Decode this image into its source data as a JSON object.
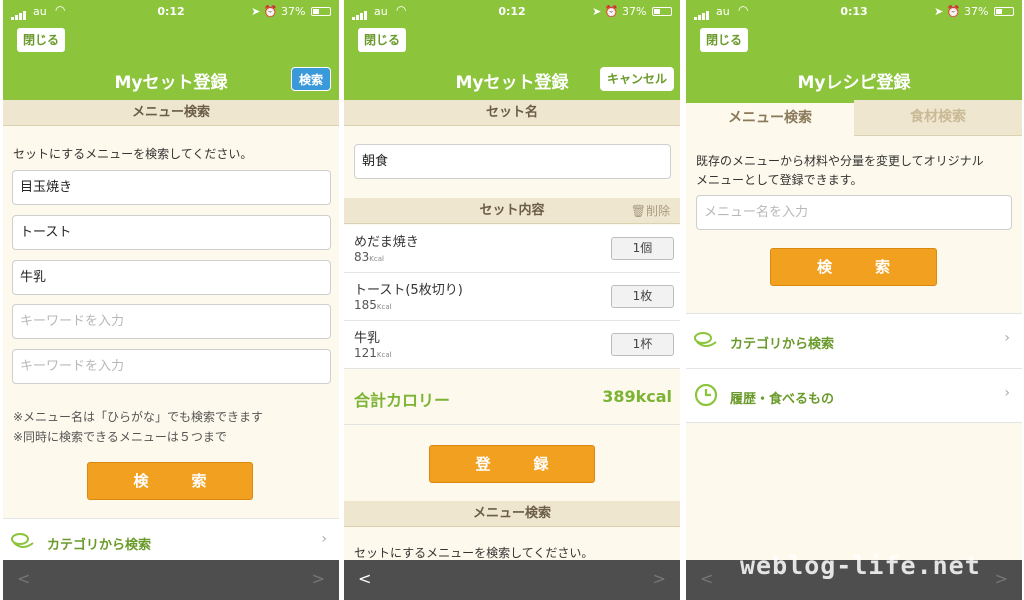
{
  "status": {
    "carrier": "au",
    "battery": "37%",
    "times": [
      "0:12",
      "0:12",
      "0:13"
    ]
  },
  "screen1": {
    "close_label": "閉じる",
    "title": "Myセット登録",
    "header_button": "検索",
    "section_title": "メニュー検索",
    "instruction": "セットにするメニューを検索してください。",
    "fields": [
      {
        "value": "目玉焼き"
      },
      {
        "value": "トースト"
      },
      {
        "value": "牛乳"
      }
    ],
    "placeholder": "キーワードを入力",
    "notes": [
      "※メニュー名は「ひらがな」でも検索できます",
      "※同時に検索できるメニューは５つまで"
    ],
    "search_button": "検　索",
    "category_link": "カテゴリから検索",
    "nav_back": "<",
    "nav_forward": ">"
  },
  "screen2": {
    "close_label": "閉じる",
    "title": "Myセット登録",
    "header_button": "キャンセル",
    "set_name_header": "セット名",
    "set_name_value": "朝食",
    "set_contents_header": "セット内容",
    "delete_label": "削除",
    "items": [
      {
        "name": "めだま焼き",
        "kcal": "83",
        "unit": "Kcal",
        "qty": "1個"
      },
      {
        "name": "トースト(5枚切り)",
        "kcal": "185",
        "unit": "Kcal",
        "qty": "1枚"
      },
      {
        "name": "牛乳",
        "kcal": "121",
        "unit": "Kcal",
        "qty": "1杯"
      }
    ],
    "total_label": "合計カロリー",
    "total_value": "389kcal",
    "register_button": "登　録",
    "menu_search_header": "メニュー検索",
    "instruction": "セットにするメニューを検索してください。",
    "nav_back": "<",
    "nav_forward": ">"
  },
  "screen3": {
    "close_label": "閉じる",
    "title": "Myレシピ登録",
    "tabs": [
      "メニュー検索",
      "食材検索"
    ],
    "description_line1": "既存のメニューから材料や分量を変更してオリジナル",
    "description_line2": "メニューとして登録できます。",
    "search_placeholder": "メニュー名を入力",
    "search_button": "検　索",
    "category_link": "カテゴリから検索",
    "history_link": "履歴・食べるもの",
    "nav_back": "<",
    "nav_forward": ">"
  },
  "watermark": "weblog-life.net",
  "colors": {
    "accent_green": "#8cc43c",
    "button_orange": "#f2a020",
    "header_blue": "#3a9ad9",
    "section_beige": "#efe6d0"
  }
}
